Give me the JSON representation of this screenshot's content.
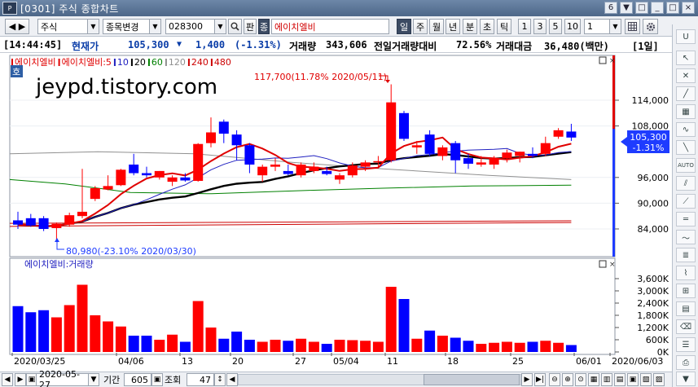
{
  "window": {
    "title": "[0301] 주식 종합차트",
    "logo": "P",
    "controls": [
      "6",
      "▼",
      "□",
      "_",
      "□",
      "×"
    ]
  },
  "toolbar": {
    "market": "주식",
    "change_item": "종목변경",
    "code": "028300",
    "search_icon": "search-icon",
    "pan_label": "판",
    "jong_label": "종",
    "stock_name": "에이치엘비",
    "periods": [
      "일",
      "주",
      "월",
      "년",
      "분",
      "초",
      "틱"
    ],
    "active_period": "일",
    "interval_presets": [
      "1",
      "3",
      "5",
      "10"
    ],
    "interval_value": "1",
    "icons": [
      "grid-icon",
      "settings-icon"
    ]
  },
  "status": {
    "time": "[14:44:45]",
    "price_label": "현재가",
    "price": "105,300",
    "change_arrow": "▼",
    "change": "1,400",
    "change_pct": "(-1.31%)",
    "volume_label": "거래량",
    "volume": "343,606",
    "prev_vol_label": "전일거래량대비",
    "prev_vol_pct": "72.56%",
    "amount_label": "거래대금",
    "amount": "36,480(백만)",
    "period_badge": "[1일]"
  },
  "legend_price": [
    {
      "text": "에이치엘비",
      "color": "#e00000"
    },
    {
      "text": "에이치엘비:5",
      "color": "#e00000"
    },
    {
      "text": "10",
      "color": "#2020c0"
    },
    {
      "text": "20",
      "color": "#000000"
    },
    {
      "text": "60",
      "color": "#008000"
    },
    {
      "text": "120",
      "color": "#909090"
    },
    {
      "text": "240",
      "color": "#cc0000"
    },
    {
      "text": "480",
      "color": "#cc0000"
    }
  ],
  "legend_volume": "에이치엘비:거래량",
  "watermark": "jeypd.tistory.com",
  "ho_badge": "호",
  "annotations": {
    "high": "117,700(11.78% 2020/05/11)",
    "low": "80,980(-23.10% 2020/03/30)"
  },
  "bottom": {
    "date": "2020-05-27",
    "period_label": "기간",
    "period_value": "605",
    "view_label": "조회",
    "view_value": "47"
  },
  "colors": {
    "up": "#ff0000",
    "down": "#0000ff",
    "current_price_box": "#1e3cff"
  },
  "chart_data": {
    "type": "candlestick",
    "price_axis_ticks": [
      "114,000",
      "108,000",
      "105,300",
      "-1.31%",
      "96,000",
      "90,000",
      "84,000"
    ],
    "volume_axis_ticks": [
      "3,600K",
      "3,000K",
      "2,400K",
      "1,800K",
      "1,200K",
      "600K",
      "0K"
    ],
    "date_labels": [
      "2020/03/25",
      "04/06",
      "13",
      "20",
      "27",
      "05/04",
      "11",
      "18",
      "25",
      "06/01",
      "2020/06/03"
    ],
    "ylim_price": [
      81000,
      118000
    ],
    "ylim_volume": [
      0,
      3600000
    ],
    "candles": [
      {
        "o": 86.0,
        "h": 88.0,
        "l": 84.0,
        "c": 85.0
      },
      {
        "o": 86.5,
        "h": 87.5,
        "l": 84.5,
        "c": 84.8
      },
      {
        "o": 86.5,
        "h": 87.0,
        "l": 83.5,
        "c": 84.0
      },
      {
        "o": 84.2,
        "h": 85.5,
        "l": 80.98,
        "c": 85.2
      },
      {
        "o": 85.0,
        "h": 87.8,
        "l": 84.5,
        "c": 87.2
      },
      {
        "o": 87.0,
        "h": 98.0,
        "l": 86.5,
        "c": 88.0
      },
      {
        "o": 91.0,
        "h": 94.0,
        "l": 90.5,
        "c": 93.5
      },
      {
        "o": 93.2,
        "h": 96.5,
        "l": 93.0,
        "c": 94.0
      },
      {
        "o": 94.2,
        "h": 98.0,
        "l": 94.0,
        "c": 97.8
      },
      {
        "o": 99.0,
        "h": 101.5,
        "l": 96.5,
        "c": 97.0
      },
      {
        "o": 97.0,
        "h": 98.5,
        "l": 96.0,
        "c": 96.5
      },
      {
        "o": 96.0,
        "h": 97.5,
        "l": 95.5,
        "c": 97.5
      },
      {
        "o": 95.0,
        "h": 96.5,
        "l": 94.0,
        "c": 96.0
      },
      {
        "o": 96.0,
        "h": 97.0,
        "l": 95.0,
        "c": 95.3
      },
      {
        "o": 95.2,
        "h": 104.0,
        "l": 95.0,
        "c": 103.8
      },
      {
        "o": 104.0,
        "h": 110.0,
        "l": 103.0,
        "c": 106.5
      },
      {
        "o": 109.0,
        "h": 109.5,
        "l": 104.0,
        "c": 106.2
      },
      {
        "o": 106.0,
        "h": 107.0,
        "l": 100.0,
        "c": 103.5
      },
      {
        "o": 103.5,
        "h": 104.0,
        "l": 97.0,
        "c": 99.0
      },
      {
        "o": 96.5,
        "h": 99.0,
        "l": 95.0,
        "c": 98.5
      },
      {
        "o": 98.5,
        "h": 100.5,
        "l": 97.5,
        "c": 99.0
      },
      {
        "o": 97.5,
        "h": 99.0,
        "l": 96.5,
        "c": 96.8
      },
      {
        "o": 96.5,
        "h": 99.5,
        "l": 96.0,
        "c": 99.0
      },
      {
        "o": 97.5,
        "h": 99.5,
        "l": 97.0,
        "c": 98.5
      },
      {
        "o": 97.5,
        "h": 98.5,
        "l": 96.5,
        "c": 96.8
      },
      {
        "o": 95.5,
        "h": 97.0,
        "l": 94.5,
        "c": 96.5
      },
      {
        "o": 96.5,
        "h": 99.5,
        "l": 96.0,
        "c": 98.8
      },
      {
        "o": 98.5,
        "h": 100.0,
        "l": 97.5,
        "c": 99.5
      },
      {
        "o": 99.5,
        "h": 101.0,
        "l": 98.5,
        "c": 99.8
      },
      {
        "o": 100.0,
        "h": 117.7,
        "l": 99.5,
        "c": 113.5
      },
      {
        "o": 111.0,
        "h": 111.5,
        "l": 104.5,
        "c": 105.0
      },
      {
        "o": 103.0,
        "h": 104.5,
        "l": 101.5,
        "c": 103.5
      },
      {
        "o": 106.0,
        "h": 107.0,
        "l": 101.0,
        "c": 101.5
      },
      {
        "o": 101.0,
        "h": 103.5,
        "l": 100.0,
        "c": 103.0
      },
      {
        "o": 104.0,
        "h": 104.5,
        "l": 97.0,
        "c": 100.0
      },
      {
        "o": 100.5,
        "h": 101.5,
        "l": 98.0,
        "c": 99.2
      },
      {
        "o": 99.0,
        "h": 101.0,
        "l": 98.5,
        "c": 99.5
      },
      {
        "o": 99.0,
        "h": 101.0,
        "l": 98.0,
        "c": 100.5
      },
      {
        "o": 100.5,
        "h": 102.5,
        "l": 99.5,
        "c": 101.8
      },
      {
        "o": 101.0,
        "h": 102.0,
        "l": 99.5,
        "c": 102.0
      },
      {
        "o": 101.5,
        "h": 103.0,
        "l": 100.5,
        "c": 101.0
      },
      {
        "o": 101.5,
        "h": 105.5,
        "l": 101.0,
        "c": 104.0
      },
      {
        "o": 105.5,
        "h": 107.5,
        "l": 105.0,
        "c": 107.0
      },
      {
        "o": 106.7,
        "h": 108.5,
        "l": 104.5,
        "c": 105.3
      }
    ],
    "volumes": [
      2250,
      1950,
      2050,
      1700,
      2300,
      3300,
      1800,
      1500,
      1250,
      800,
      800,
      600,
      850,
      500,
      2500,
      1200,
      650,
      1000,
      600,
      500,
      600,
      550,
      650,
      500,
      400,
      600,
      580,
      550,
      500,
      3200,
      2600,
      650,
      1050,
      800,
      700,
      550,
      400,
      450,
      500,
      450,
      500,
      550,
      450,
      340
    ],
    "volume_unit": "K"
  }
}
